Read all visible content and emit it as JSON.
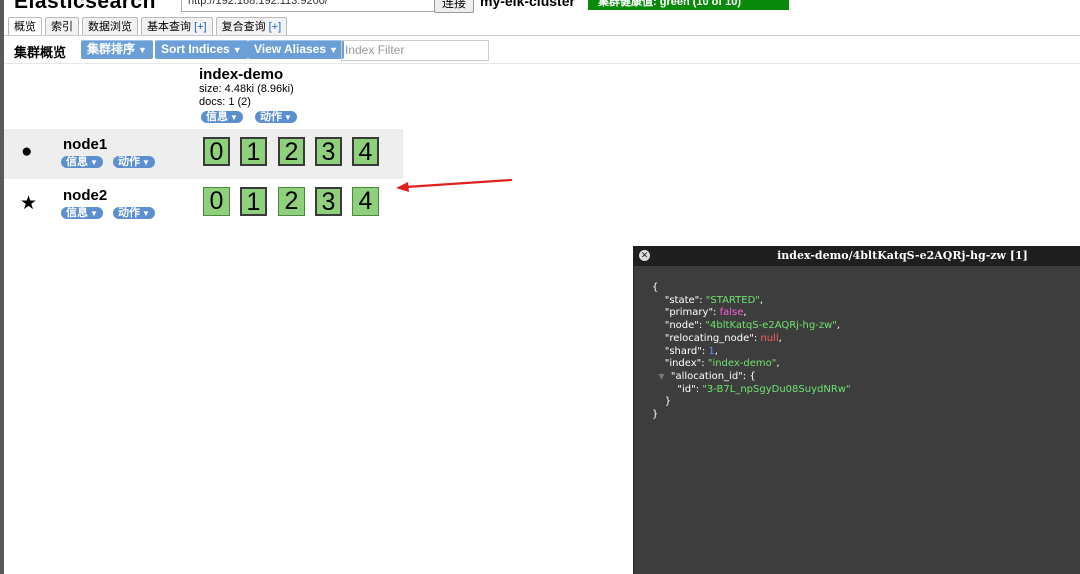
{
  "header": {
    "title": "Elasticsearch",
    "url": "http://192.168.192.113:9200/",
    "connect_label": "连接",
    "cluster_name": "my-elk-cluster",
    "health": "集群健康值: green (10 of 10)",
    "health_color": "#0a8a0a"
  },
  "tabs": [
    {
      "label": "概览",
      "plus": ""
    },
    {
      "label": "索引",
      "plus": ""
    },
    {
      "label": "数据浏览",
      "plus": ""
    },
    {
      "label": "基本查询 ",
      "plus": "[+]"
    },
    {
      "label": "复合查询 ",
      "plus": "[+]"
    }
  ],
  "toolbar": {
    "title": "集群概览",
    "sort_cluster_label": "集群排序",
    "sort_indices_label": "Sort Indices",
    "view_aliases_label": "View Aliases",
    "filter_placeholder": "Index Filter"
  },
  "index": {
    "name": "index-demo",
    "size": "size: 4.48ki (8.96ki)",
    "docs": "docs: 1 (2)",
    "info_label": "信息",
    "action_label": "动作"
  },
  "nodes": [
    {
      "name": "node1",
      "info_label": "信息",
      "action_label": "动作",
      "shards": [
        "0",
        "1",
        "2",
        "3",
        "4"
      ]
    },
    {
      "name": "node2",
      "info_label": "信息",
      "action_label": "动作",
      "shards": [
        "0",
        "1",
        "2",
        "3",
        "4"
      ]
    }
  ],
  "popup": {
    "title": "index-demo/4bltKatqS-e2AQRj-hg-zw [1]",
    "json": {
      "state": "STARTED",
      "primary": "false",
      "node": "4bltKatqS-e2AQRj-hg-zw",
      "relocating_node": "null",
      "shard": "1",
      "index": "index-demo",
      "allocation_id_id": "3-B7L_npSgyDu08SuydNRw"
    }
  },
  "colors": {
    "accent": "#6c9fd6",
    "shard_green": "#8fd07c",
    "arrow": "#e02020"
  }
}
